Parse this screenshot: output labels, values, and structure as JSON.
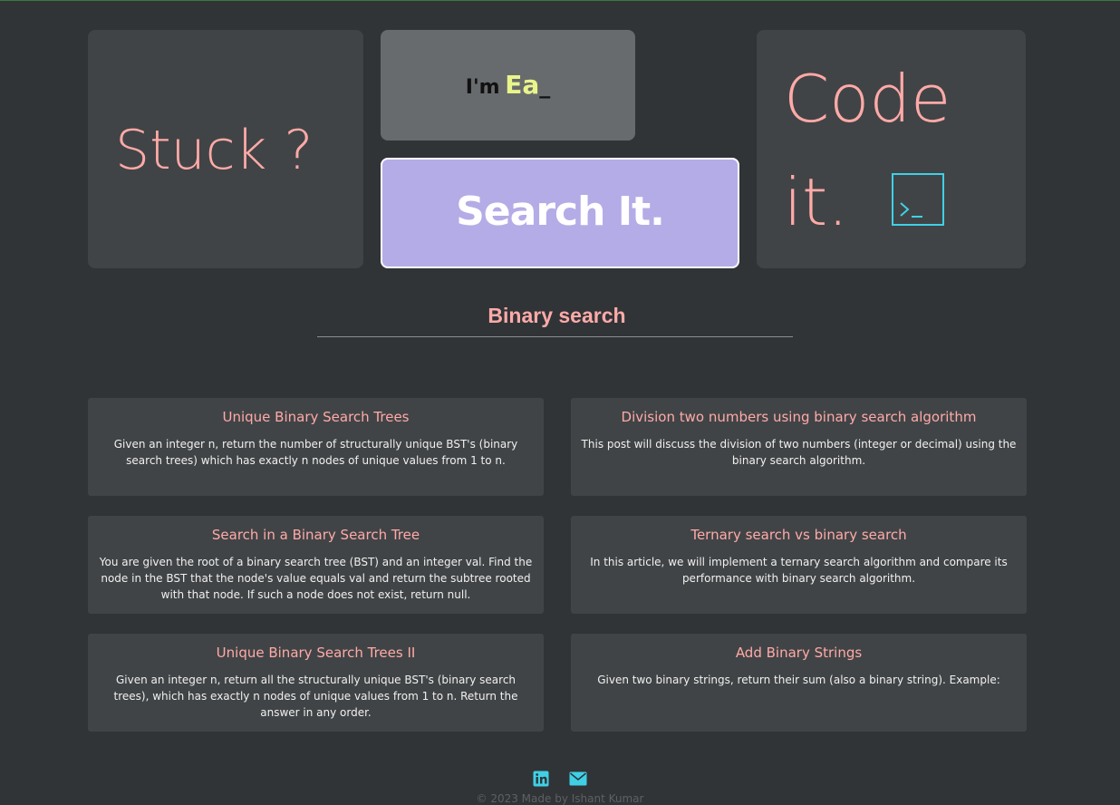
{
  "hero": {
    "stuck_text": "Stuck ?",
    "typer_prefix": "I'm",
    "typer_word": "Ea",
    "typer_cursor": "_",
    "search_button": "Search It.",
    "code_line1": "Code",
    "code_line2": "it.",
    "terminal_icon": "terminal-icon"
  },
  "search": {
    "value": "Binary search"
  },
  "results": [
    {
      "title": "Unique Binary Search Trees",
      "desc": "Given an integer n, return the number of structurally unique BST's (binary search trees) which has exactly n nodes of unique values from 1 to n."
    },
    {
      "title": "Division two numbers using binary search algorithm",
      "desc": "This post will discuss the division of two numbers (integer or decimal) using the binary search algorithm."
    },
    {
      "title": "Search in a Binary Search Tree",
      "desc": "You are given the root of a binary search tree (BST) and an integer val. Find the node in the BST that the node's value equals val and return the subtree rooted with that node. If such a node does not exist, return null."
    },
    {
      "title": "Ternary search vs binary search",
      "desc": "In this article, we will implement a ternary search algorithm and compare its performance with binary search algorithm."
    },
    {
      "title": "Unique Binary Search Trees II",
      "desc": "Given an integer n, return all the structurally unique BST's (binary search trees), which has exactly n nodes of unique values from 1 to n. Return the answer in any order."
    },
    {
      "title": "Add Binary Strings",
      "desc": "Given two binary strings, return their sum (also a binary string). Example:"
    }
  ],
  "footer": {
    "icons": [
      "linkedin-icon",
      "email-icon"
    ],
    "credit": "© 2023 Made by Ishant Kumar"
  },
  "colors": {
    "background": "#303437",
    "tile": "#414446",
    "accent_pink": "#ffaaa8",
    "search_button": "#b4ace6",
    "typer_word": "#e9f58a",
    "icon_cyan": "#3fd0e6"
  }
}
